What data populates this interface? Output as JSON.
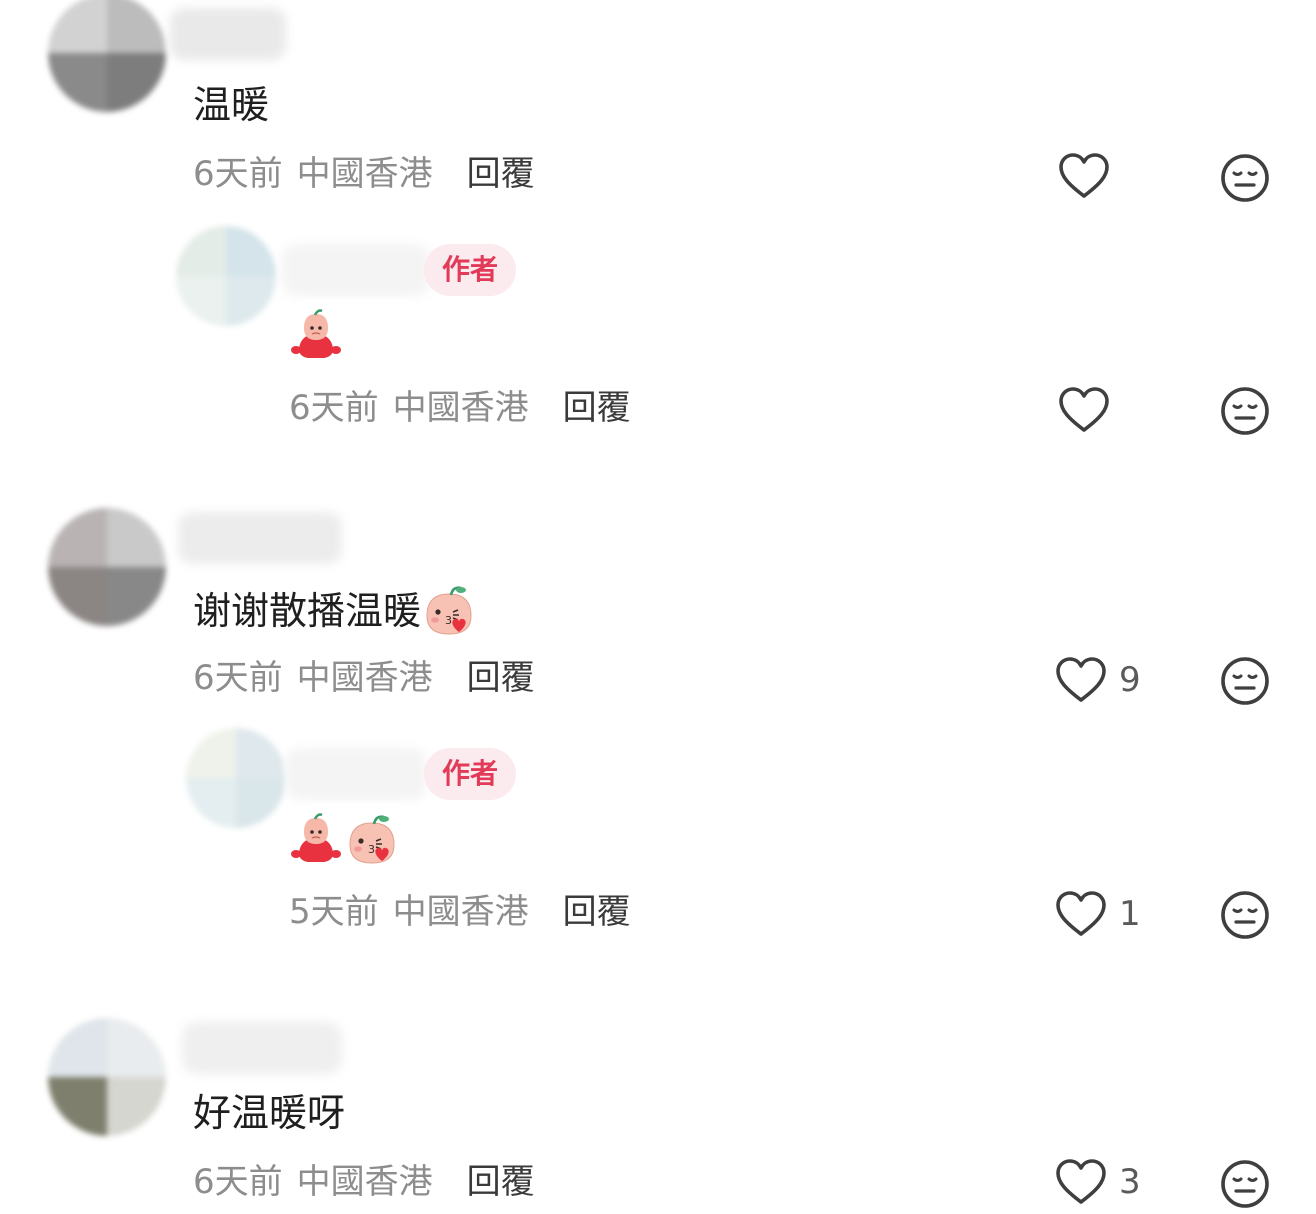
{
  "comments": [
    {
      "text": "温暖",
      "time": "6天前",
      "location": "中國香港",
      "reply_label": "回覆",
      "likes": "",
      "replies": [
        {
          "badge": "作者",
          "emoji": [
            "blob-red-icon"
          ],
          "time": "6天前",
          "location": "中國香港",
          "reply_label": "回覆",
          "likes": ""
        }
      ]
    },
    {
      "text": "谢谢散播温暖",
      "trailing_emoji": "kiss-face-icon",
      "time": "6天前",
      "location": "中國香港",
      "reply_label": "回覆",
      "likes": "9",
      "replies": [
        {
          "badge": "作者",
          "emoji": [
            "blob-red-icon",
            "kiss-face-icon"
          ],
          "time": "5天前",
          "location": "中國香港",
          "reply_label": "回覆",
          "likes": "1"
        }
      ]
    },
    {
      "text": "好温暖呀",
      "time": "6天前",
      "location": "中國香港",
      "reply_label": "回覆",
      "likes": "3",
      "replies": []
    }
  ],
  "colors": {
    "meta_gray": "#8d8d8d",
    "reply_dark": "#3a3a3a",
    "badge_bg": "#fbeaee",
    "badge_text": "#e23b5a",
    "icon_stroke": "#3f3f3f"
  }
}
